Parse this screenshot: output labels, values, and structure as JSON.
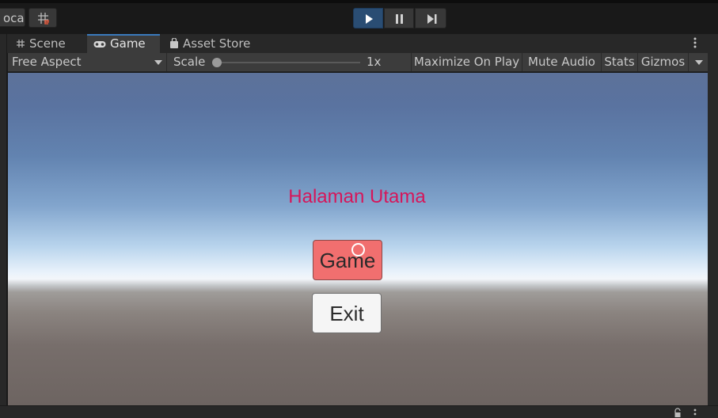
{
  "toolbar": {
    "local_label": "ocal",
    "play_icon": "play-icon",
    "pause_icon": "pause-icon",
    "step_icon": "step-icon",
    "grid_icon": "grid-snap-icon"
  },
  "tabs": [
    {
      "label": "Scene",
      "icon": "scene-grid-icon"
    },
    {
      "label": "Game",
      "icon": "gamepad-icon",
      "active": true
    },
    {
      "label": "Asset Store",
      "icon": "bag-icon"
    }
  ],
  "game_toolbar": {
    "aspect": "Free Aspect",
    "scale_label": "Scale",
    "scale_value": "1x",
    "maximize": "Maximize On Play",
    "mute": "Mute Audio",
    "stats": "Stats",
    "gizmos": "Gizmos"
  },
  "game": {
    "title": "Halaman Utama",
    "play_button": "Game",
    "exit_button": "Exit"
  },
  "colors": {
    "title_text": "#d6165a",
    "game_button_bg": "#f16f6f",
    "exit_button_bg": "#f5f5f5",
    "play_active": "#2a4d73",
    "tab_accent": "#3a79bb"
  }
}
